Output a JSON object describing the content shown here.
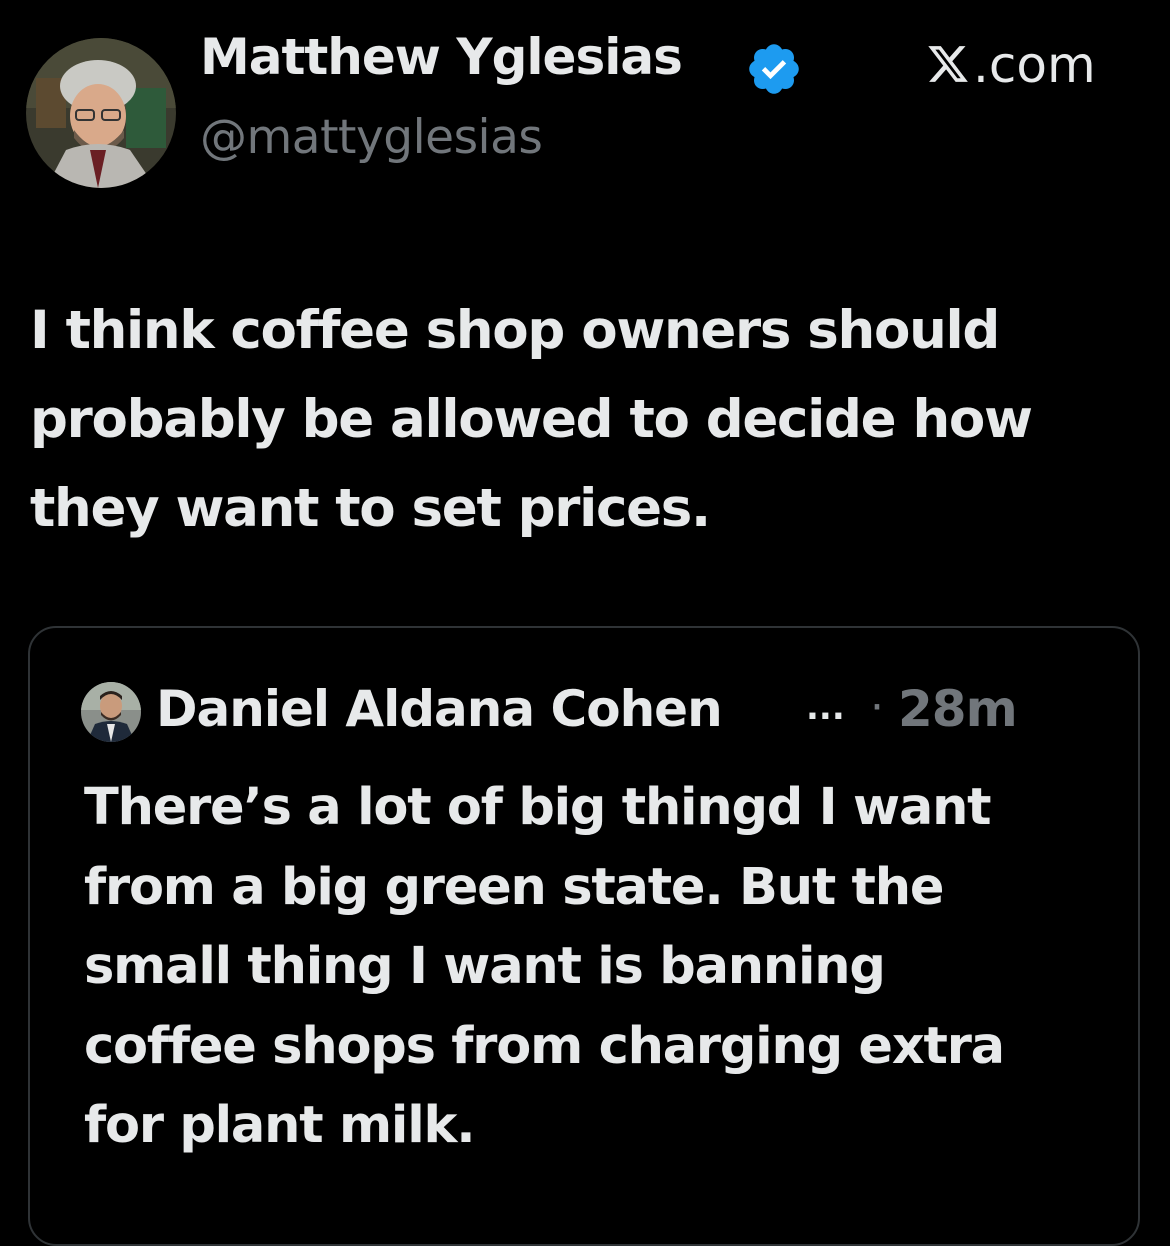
{
  "tweet": {
    "author": {
      "display_name": "Matthew Yglesias",
      "handle": "@mattyglesias",
      "verified": true,
      "verified_badge_color": "#1d9bf0"
    },
    "source": {
      "label": ".com",
      "logo_icon": "x-logo-icon"
    },
    "text_lines": [
      "I think coffee shop owners should",
      "probably be allowed to decide how",
      "they want to set prices."
    ],
    "quoted_tweet": {
      "author_name": "Daniel Aldana Cohen",
      "truncation": "...",
      "separator": "·",
      "time_ago": "28m",
      "text_lines": [
        "There’s a lot of big thingd I want",
        "from a big green state. But the",
        "small thing I want is banning",
        "coffee shops from charging extra",
        "for plant milk."
      ]
    }
  },
  "colors": {
    "background": "#000000",
    "primary_text": "#e7e9ea",
    "secondary_text": "#71767b",
    "card_border": "#2f3336"
  }
}
